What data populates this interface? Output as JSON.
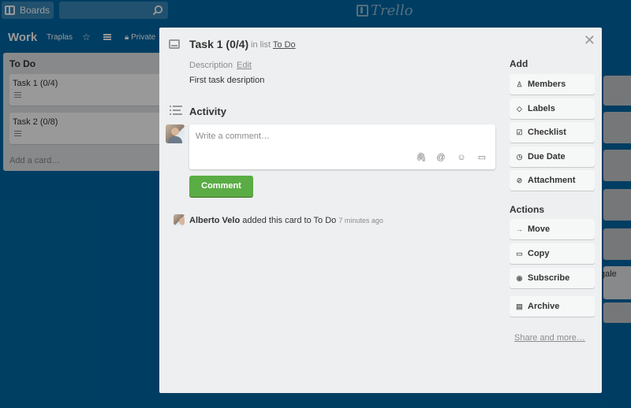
{
  "topbar": {
    "boards_label": "Boards",
    "logo_text": "Trello"
  },
  "board": {
    "title": "Work",
    "team": "Traplas",
    "privacy": "Private"
  },
  "list": {
    "title": "To Do",
    "cards": [
      {
        "title": "Task 1 (0/4)"
      },
      {
        "title": "Task 2 (0/8)"
      }
    ],
    "add_card": "Add a card…"
  },
  "background_text": "gale",
  "modal": {
    "title": "Task 1 (0/4)",
    "in_list_prefix": "in list",
    "list_name": "To Do",
    "description_label": "Description",
    "edit_label": "Edit",
    "description_text": "First task desription",
    "activity_label": "Activity",
    "comment_placeholder": "Write a comment…",
    "comment_button": "Comment",
    "activity_entry": {
      "user": "Alberto Velo",
      "action": "added this card to To Do",
      "time": "7 minutes ago"
    }
  },
  "sidebar": {
    "add_heading": "Add",
    "add_buttons": [
      {
        "label": "Members",
        "icon": "person-icon"
      },
      {
        "label": "Labels",
        "icon": "tag-icon"
      },
      {
        "label": "Checklist",
        "icon": "checkbox-icon"
      },
      {
        "label": "Due Date",
        "icon": "clock-icon"
      },
      {
        "label": "Attachment",
        "icon": "paperclip-icon"
      }
    ],
    "actions_heading": "Actions",
    "action_buttons": [
      {
        "label": "Move",
        "icon": "arrow-right-icon"
      },
      {
        "label": "Copy",
        "icon": "card-icon"
      },
      {
        "label": "Subscribe",
        "icon": "eye-icon"
      },
      {
        "label": "Archive",
        "icon": "archive-icon"
      }
    ],
    "share_label": "Share and more…"
  },
  "colors": {
    "board_bg": "#0067a3",
    "comment_button": "#5aac44",
    "modal_bg": "#edeff0"
  }
}
